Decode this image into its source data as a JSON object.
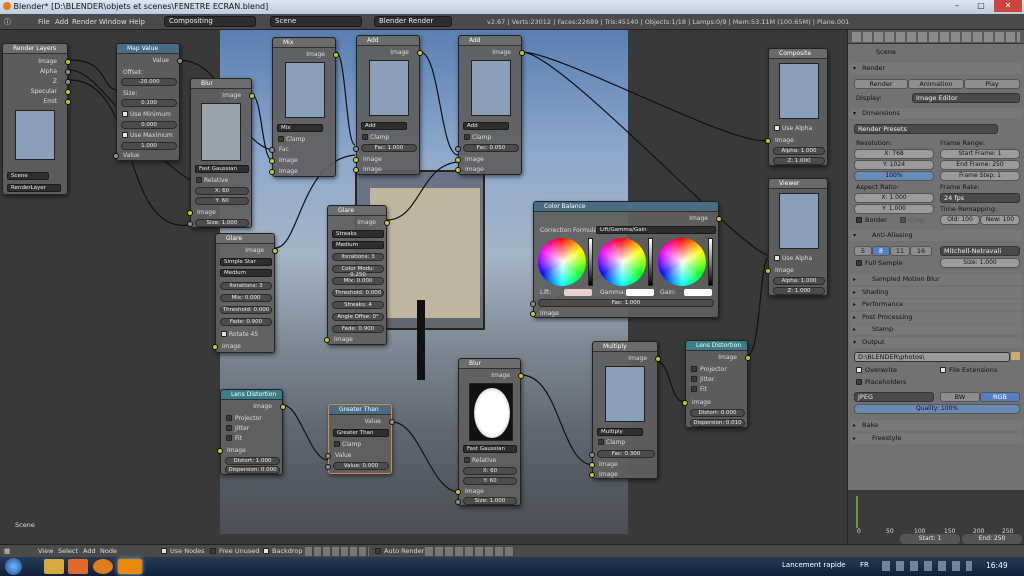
{
  "window": {
    "title": "Blender* [D:\\BLENDER\\objets et scenes\\FENETRE ECRAN.blend]",
    "min": "–",
    "max": "□",
    "close": "✕"
  },
  "header": {
    "menus": [
      "File",
      "Add",
      "Render",
      "Window",
      "Help"
    ],
    "layout": "Compositing",
    "scene": "Scene",
    "engine": "Blender Render",
    "stats": "v2.67 | Verts:23012 | Faces:22689 | Tris:45140 | Objects:1/18 | Lamps:0/9 | Mem:53.11M (100.65M) | Plane.001"
  },
  "nodes": {
    "render_layers": {
      "title": "Render Layers",
      "outputs": [
        "Image",
        "Alpha",
        "Z",
        "Specular",
        "Emit"
      ],
      "scene": "Scene",
      "layer": "RenderLayer"
    },
    "map_value": {
      "title": "Map Value",
      "output": "Value",
      "offset_label": "Offset:",
      "offset": "-20.000",
      "size_label": "Size:",
      "size": "0.100",
      "use_min": "Use Minimum",
      "min": "0.000",
      "use_max": "Use Maximum",
      "max": "1.000",
      "input": "Value"
    },
    "blur1": {
      "title": "Blur",
      "output": "Image",
      "type": "Fast Gaussian",
      "relative": "Relative",
      "x": "X: 60",
      "y": "Y: 60",
      "input": "Image",
      "size": "Size: 1.000"
    },
    "mix": {
      "title": "Mix",
      "output": "Image",
      "mode": "Mix",
      "clamp": "Clamp",
      "fac": "Fac",
      "in1": "Image",
      "in2": "Image"
    },
    "add1": {
      "title": "Add",
      "output": "Image",
      "mode": "Add",
      "clamp": "Clamp",
      "fac": "Fac: 1.000",
      "in1": "Image",
      "in2": "Image"
    },
    "add2": {
      "title": "Add",
      "output": "Image",
      "mode": "Add",
      "clamp": "Clamp",
      "fac": "Fac: 0.050",
      "in1": "Image",
      "in2": "Image"
    },
    "composite": {
      "title": "Composite",
      "use_alpha": "Use Alpha",
      "image": "Image",
      "alpha": "Alpha: 1.000",
      "z": "Z: 1.000"
    },
    "viewer": {
      "title": "Viewer",
      "use_alpha": "Use Alpha",
      "image": "Image",
      "alpha": "Alpha: 1.000",
      "z": "Z: 1.000"
    },
    "glare1": {
      "title": "Glare",
      "output": "Image",
      "type": "Simple Star",
      "quality": "Medium",
      "iterations": "Iterations: 3",
      "mix": "Mix: 0.000",
      "threshold": "Threshold: 0.000",
      "fade": "Fade: 0.900",
      "rotate": "Rotate 45",
      "input": "Image"
    },
    "glare2": {
      "title": "Glare",
      "output": "Image",
      "type": "Streaks",
      "quality": "Medium",
      "iterations": "Iterations: 3",
      "color_mod": "Color Modu: 0.250",
      "mix": "Mix: 0.000",
      "threshold": "Threshold: 0.000",
      "streaks": "Streaks: 4",
      "angle": "Angle Offse: 0°",
      "fade": "Fade: 0.900",
      "input": "Image"
    },
    "color_balance": {
      "title": "Color Balance",
      "output": "Image",
      "formula_label": "Correction Formula:",
      "formula": "Lift/Gamma/Gain",
      "lift": "Lift:",
      "gamma": "Gamma:",
      "gain": "Gain:",
      "fac": "Fac: 1.000",
      "input": "Image"
    },
    "lens1": {
      "title": "Lens Distortion",
      "output": "Image",
      "projector": "Projector",
      "jitter": "Jitter",
      "fit": "Fit",
      "input": "Image",
      "distort": "Distort: 1.000",
      "dispersion": "Dispersion: 0.000"
    },
    "greater_than": {
      "title": "Greater Than",
      "output": "Value",
      "mode": "Greater Than",
      "clamp": "Clamp",
      "input": "Value",
      "value": "Value: 0.000"
    },
    "blur2": {
      "title": "Blur",
      "output": "Image",
      "type": "Fast Gaussian",
      "relative": "Relative",
      "x": "X: 60",
      "y": "Y: 60",
      "input": "Image",
      "size": "Size: 1.000"
    },
    "multiply": {
      "title": "Multiply",
      "output": "Image",
      "mode": "Multiply",
      "clamp": "Clamp",
      "fac": "Fac: 0.300",
      "in1": "Image",
      "in2": "Image"
    },
    "lens2": {
      "title": "Lens Distortion",
      "output": "Image",
      "projector": "Projector",
      "jitter": "Jitter",
      "fit": "Fit",
      "input": "Image",
      "distort": "Distort: 0.000",
      "dispersion": "Dispersion: 0.010"
    }
  },
  "editor_label": "Scene",
  "props": {
    "scene_crumb": "Scene",
    "render_section": "Render",
    "render_btn": "Render",
    "animation_btn": "Animation",
    "play_btn": "Play",
    "display_label": "Display:",
    "display": "Image Editor",
    "dimensions": "Dimensions",
    "presets": "Render Presets",
    "resolution": "Resolution:",
    "res_x": "X: 768",
    "res_y": "Y: 1024",
    "res_pct": "100%",
    "frame_range": "Frame Range:",
    "start_frame": "Start Frame: 1",
    "end_frame": "End Frame: 250",
    "frame_step": "Frame Step: 1",
    "aspect": "Aspect Ratio:",
    "asp_x": "X: 1.000",
    "asp_y": "Y: 1.000",
    "frame_rate": "Frame Rate:",
    "fps": "24 fps",
    "time_remap": "Time Remapping:",
    "old": "Old: 100",
    "new": "New: 100",
    "border": "Border",
    "crop": "Crop",
    "anti_aliasing": "Anti-Aliasing",
    "aa_samples": [
      "5",
      "8",
      "11",
      "16"
    ],
    "aa_filter": "Mitchell-Netravali",
    "full_sample": "Full Sample",
    "aa_size": "Size: 1.000",
    "collapsed": [
      "Sampled Motion Blur",
      "Shading",
      "Performance",
      "Post Processing",
      "Stamp"
    ],
    "output": "Output",
    "path": "D:\\BLENDER\\photos\\",
    "overwrite": "Overwrite",
    "file_ext": "File Extensions",
    "placeholders": "Placeholders",
    "format": "JPEG",
    "bw": "BW",
    "rgb": "RGB",
    "quality": "Quality: 100%",
    "bake": "Bake",
    "freestyle": "Freestyle"
  },
  "timeline": {
    "ticks": [
      "0",
      "50",
      "100",
      "150",
      "200",
      "250"
    ],
    "start": "Start: 1",
    "end": "End: 250"
  },
  "bottombar": {
    "menus": [
      "View",
      "Select",
      "Add",
      "Node"
    ],
    "use_nodes": "Use Nodes",
    "free_unused": "Free Unused",
    "backdrop": "Backdrop",
    "auto_render": "Auto Render"
  },
  "taskbar": {
    "quick_launch": "Lancement rapide",
    "lang": "FR",
    "time": "16:49"
  }
}
